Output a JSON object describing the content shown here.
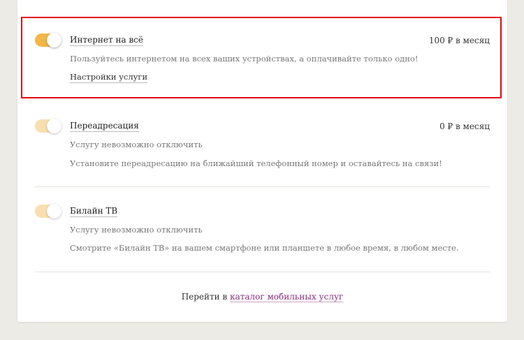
{
  "services": [
    {
      "title": "Интернет на всё",
      "price": "100 ₽ в месяц",
      "description": "Пользуйтесь интернетом на всех ваших устройствах, а оплачивайте только одно!",
      "settings_link": "Настройки услуги",
      "toggle_state": "on"
    },
    {
      "title": "Переадресация",
      "price": "0 ₽ в месяц",
      "status": "Услугу невозможно отключить",
      "description": "Установите переадресацию на ближайший телефонный номер и оставайтесь на связи!",
      "toggle_state": "on-locked"
    },
    {
      "title": "Билайн ТВ",
      "status": "Услугу невозможно отключить",
      "description": "Смотрите «Билайн ТВ» на вашем смартфоне или планшете в любое время, в любом месте.",
      "toggle_state": "on-locked"
    }
  ],
  "footer": {
    "prefix": "Перейти в",
    "catalog_link": "каталог мобильных услуг"
  },
  "colors": {
    "toggle_active": "#f3b747",
    "toggle_locked": "#f9dfb0",
    "highlight_border": "#e30613",
    "link_accent": "#8a2a80",
    "page_background": "#edebe6"
  }
}
